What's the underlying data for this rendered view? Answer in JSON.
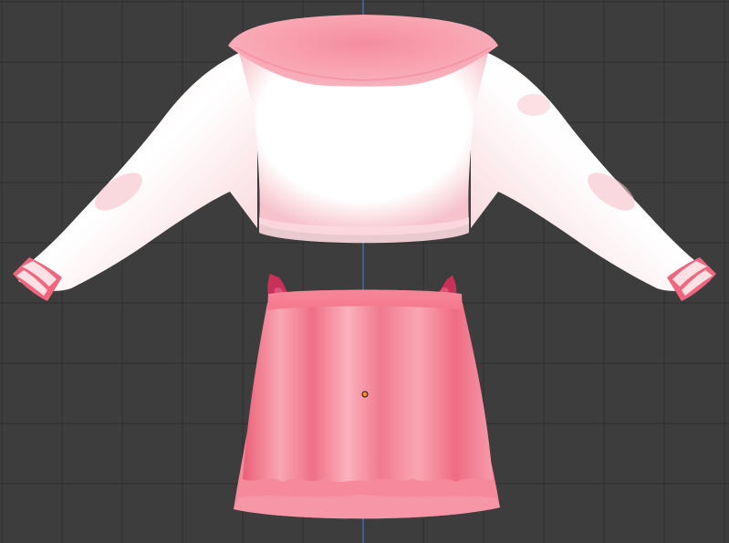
{
  "viewport": {
    "background": "#3d3d3d",
    "grid_color": "#2f2f2f",
    "axis_color": "#4a7ecb",
    "origin_color": "#ff8c1a"
  },
  "garment": {
    "shirt_color": "#ffffff",
    "shirt_shadow": "#f6c2cb",
    "collar_color": "#f9a3b0",
    "collar_shadow": "#f28a9c",
    "cuff_color": "#f0667e",
    "stripe_color": "#fbe0e4",
    "skirt_color": "#f47f92",
    "skirt_light": "#fbb2bd",
    "skirt_dark": "#ea5f78",
    "bow_color": "#c9305a"
  }
}
